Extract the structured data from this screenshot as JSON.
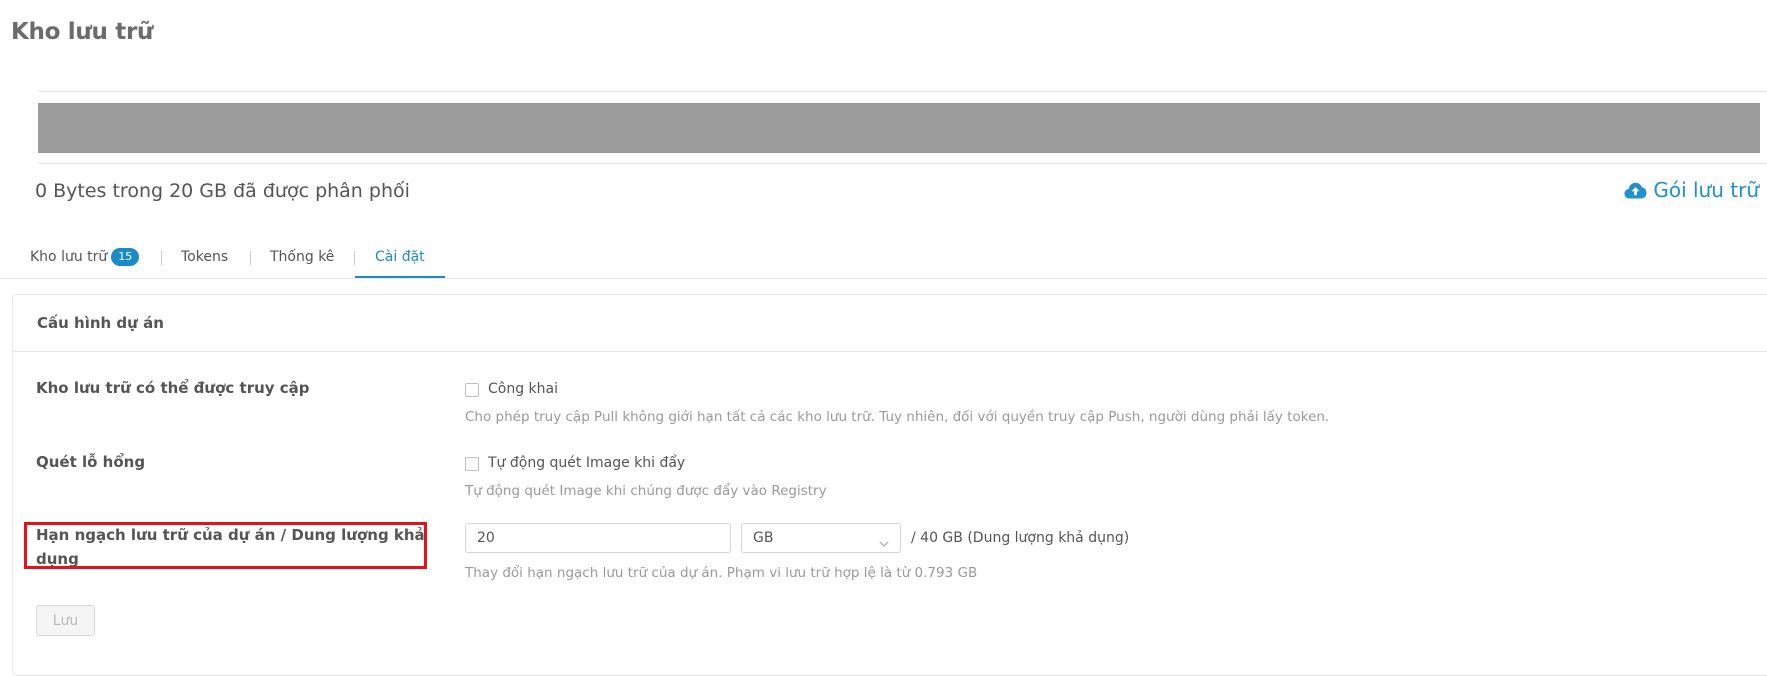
{
  "page": {
    "title": "Kho lưu trữ"
  },
  "usage": {
    "summary": "0 Bytes trong 20 GB đã được phân phối",
    "used_fraction": 0,
    "package_link": "Gói lưu trữ",
    "package_icon": "cloud-upload-icon"
  },
  "tabs": [
    {
      "label": "Kho lưu trữ",
      "badge": "15",
      "active": false
    },
    {
      "label": "Tokens",
      "active": false
    },
    {
      "label": "Thống kê",
      "active": false
    },
    {
      "label": "Cài đặt",
      "active": true
    }
  ],
  "settings": {
    "title": "Cấu hình dự án",
    "access": {
      "label": "Kho lưu trữ có thể được truy cập",
      "checkbox_label": "Công khai",
      "checked": false,
      "help": "Cho phép truy cập Pull không giới hạn tất cả các kho lưu trữ. Tuy nhiên, đối với quyền truy cập Push, người dùng phải lấy token."
    },
    "scan": {
      "label": "Quét lỗ hổng",
      "checkbox_label": "Tự động quét Image khi đẩy",
      "checked": false,
      "help": "Tự động quét Image khi chúng được đẩy vào Registry"
    },
    "quota": {
      "label": "Hạn ngạch lưu trữ của dự án / Dung lượng khả dụng",
      "value": "20",
      "unit": "GB",
      "available": "/ 40 GB (Dung lượng khả dụng)",
      "help": "Thay đổi hạn ngạch lưu trữ của dự án. Phạm vi lưu trữ hợp lệ là từ 0.793 GB"
    },
    "save_label": "Lưu"
  },
  "colors": {
    "accent": "#1b8bc8",
    "usage_bar": "#9b9b9b",
    "highlight_border": "#e8101a"
  }
}
